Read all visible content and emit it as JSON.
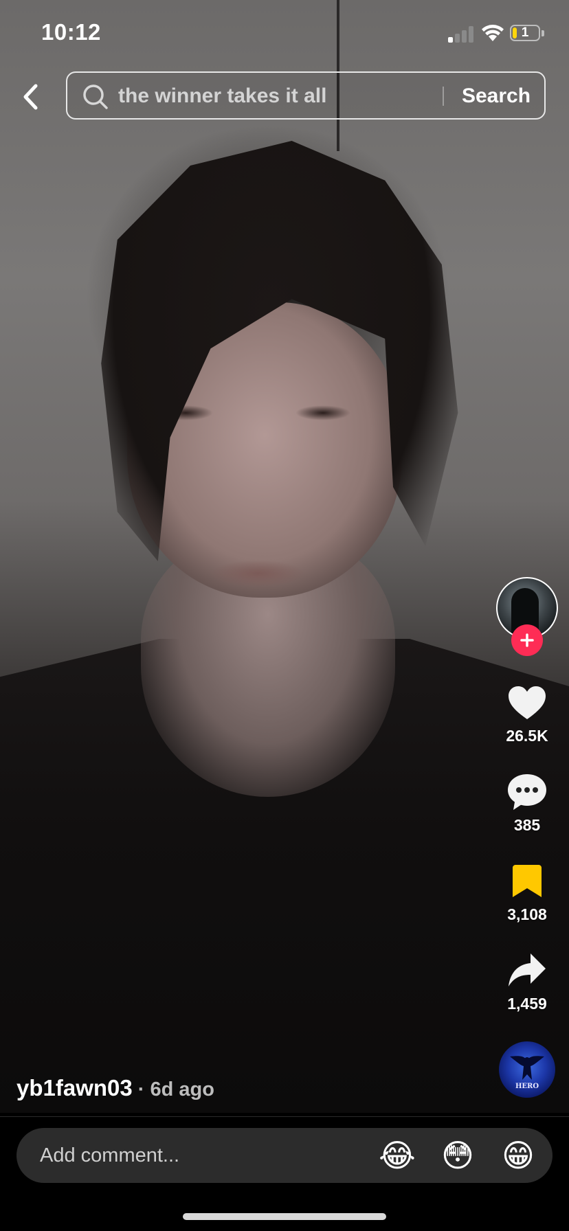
{
  "status_bar": {
    "time": "10:12",
    "battery_percent": "1"
  },
  "search": {
    "query": "the winner takes it all",
    "button_label": "Search"
  },
  "actions": {
    "likes": "26.5K",
    "comments": "385",
    "saves": "3,108",
    "shares": "1,459"
  },
  "post": {
    "username": "yb1fawn03",
    "time_ago": " · 6d ago"
  },
  "music_disc": {
    "label": "HERO"
  },
  "comment_bar": {
    "placeholder": "Add comment...",
    "emojis": [
      "😂",
      "😳",
      "😁"
    ]
  },
  "colors": {
    "follow_accent": "#fe2c55",
    "bookmark_active": "#ffc800",
    "battery_low": "#ffd60a"
  }
}
